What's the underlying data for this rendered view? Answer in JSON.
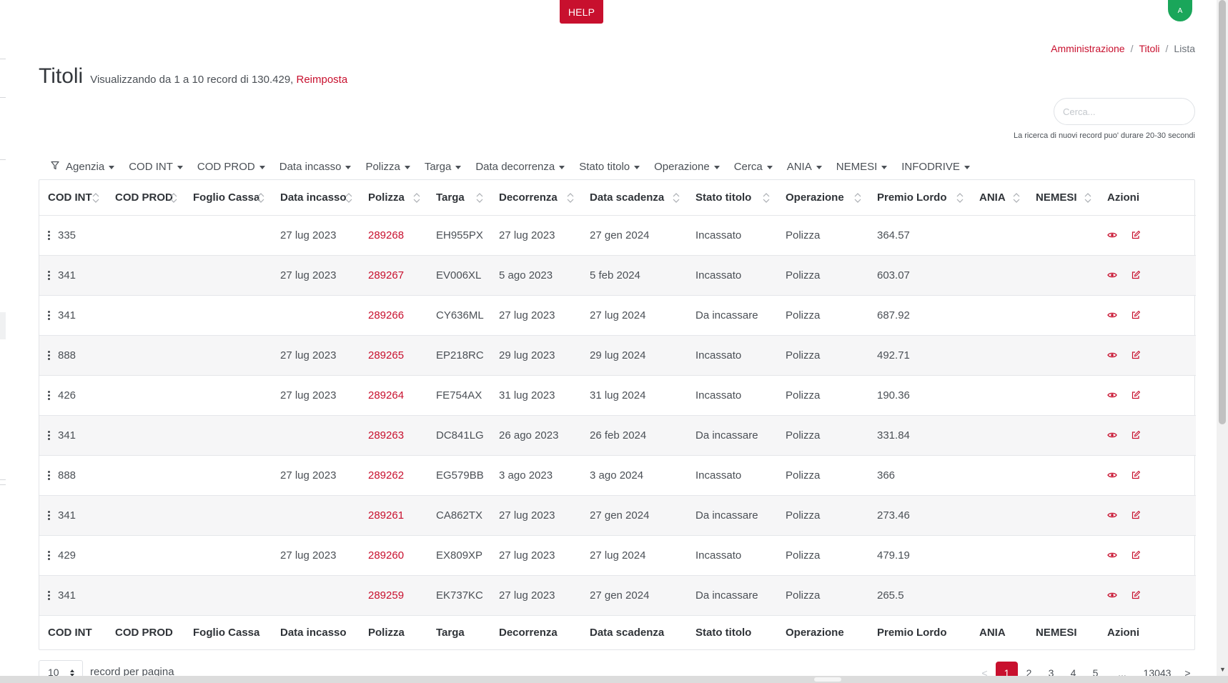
{
  "header": {
    "help_label": "HELP",
    "avatar_initial": "A"
  },
  "breadcrumb": {
    "items": [
      "Amministrazione",
      "Titoli"
    ],
    "current": "Lista",
    "separator": "/"
  },
  "page": {
    "title": "Titoli",
    "subtitle": "Visualizzando da 1 a 10 record di 130.429,",
    "reset_label": "Reimposta"
  },
  "search": {
    "placeholder": "Cerca...",
    "note": "La ricerca di nuovi record puo' durare 20-30 secondi"
  },
  "filters": [
    "Agenzia",
    "COD INT",
    "COD PROD",
    "Data incasso",
    "Polizza",
    "Targa",
    "Data decorrenza",
    "Stato titolo",
    "Operazione",
    "Cerca",
    "ANIA",
    "NEMESI",
    "INFODRIVE"
  ],
  "table": {
    "columns": [
      "COD INT",
      "COD PROD",
      "Foglio Cassa",
      "Data incasso",
      "Polizza",
      "Targa",
      "Decorrenza",
      "Data scadenza",
      "Stato titolo",
      "Operazione",
      "Premio Lordo",
      "ANIA",
      "NEMESI",
      "Azioni"
    ],
    "rows": [
      {
        "cod_int": "335",
        "cod_prod": "",
        "foglio_cassa": "",
        "data_incasso": "27 lug 2023",
        "polizza": "289268",
        "targa": "EH955PX",
        "decorrenza": "27 lug 2023",
        "data_scadenza": "27 gen 2024",
        "stato": "Incassato",
        "operazione": "Polizza",
        "premio": "364.57",
        "ania": "",
        "nemesi": ""
      },
      {
        "cod_int": "341",
        "cod_prod": "",
        "foglio_cassa": "",
        "data_incasso": "27 lug 2023",
        "polizza": "289267",
        "targa": "EV006XL",
        "decorrenza": "5 ago 2023",
        "data_scadenza": "5 feb 2024",
        "stato": "Incassato",
        "operazione": "Polizza",
        "premio": "603.07",
        "ania": "",
        "nemesi": ""
      },
      {
        "cod_int": "341",
        "cod_prod": "",
        "foglio_cassa": "",
        "data_incasso": "",
        "polizza": "289266",
        "targa": "CY636ML",
        "decorrenza": "27 lug 2023",
        "data_scadenza": "27 lug 2024",
        "stato": "Da incassare",
        "operazione": "Polizza",
        "premio": "687.92",
        "ania": "",
        "nemesi": ""
      },
      {
        "cod_int": "888",
        "cod_prod": "",
        "foglio_cassa": "",
        "data_incasso": "27 lug 2023",
        "polizza": "289265",
        "targa": "EP218RC",
        "decorrenza": "29 lug 2023",
        "data_scadenza": "29 lug 2024",
        "stato": "Incassato",
        "operazione": "Polizza",
        "premio": "492.71",
        "ania": "",
        "nemesi": ""
      },
      {
        "cod_int": "426",
        "cod_prod": "",
        "foglio_cassa": "",
        "data_incasso": "27 lug 2023",
        "polizza": "289264",
        "targa": "FE754AX",
        "decorrenza": "31 lug 2023",
        "data_scadenza": "31 lug 2024",
        "stato": "Incassato",
        "operazione": "Polizza",
        "premio": "190.36",
        "ania": "",
        "nemesi": ""
      },
      {
        "cod_int": "341",
        "cod_prod": "",
        "foglio_cassa": "",
        "data_incasso": "",
        "polizza": "289263",
        "targa": "DC841LG",
        "decorrenza": "26 ago 2023",
        "data_scadenza": "26 feb 2024",
        "stato": "Da incassare",
        "operazione": "Polizza",
        "premio": "331.84",
        "ania": "",
        "nemesi": ""
      },
      {
        "cod_int": "888",
        "cod_prod": "",
        "foglio_cassa": "",
        "data_incasso": "27 lug 2023",
        "polizza": "289262",
        "targa": "EG579BB",
        "decorrenza": "3 ago 2023",
        "data_scadenza": "3 ago 2024",
        "stato": "Incassato",
        "operazione": "Polizza",
        "premio": "366",
        "ania": "",
        "nemesi": ""
      },
      {
        "cod_int": "341",
        "cod_prod": "",
        "foglio_cassa": "",
        "data_incasso": "",
        "polizza": "289261",
        "targa": "CA862TX",
        "decorrenza": "27 lug 2023",
        "data_scadenza": "27 gen 2024",
        "stato": "Da incassare",
        "operazione": "Polizza",
        "premio": "273.46",
        "ania": "",
        "nemesi": ""
      },
      {
        "cod_int": "429",
        "cod_prod": "",
        "foglio_cassa": "",
        "data_incasso": "27 lug 2023",
        "polizza": "289260",
        "targa": "EX809XP",
        "decorrenza": "27 lug 2023",
        "data_scadenza": "27 lug 2024",
        "stato": "Incassato",
        "operazione": "Polizza",
        "premio": "479.19",
        "ania": "",
        "nemesi": ""
      },
      {
        "cod_int": "341",
        "cod_prod": "",
        "foglio_cassa": "",
        "data_incasso": "",
        "polizza": "289259",
        "targa": "EK737KC",
        "decorrenza": "27 lug 2023",
        "data_scadenza": "27 gen 2024",
        "stato": "Da incassare",
        "operazione": "Polizza",
        "premio": "265.5",
        "ania": "",
        "nemesi": ""
      }
    ],
    "row_action_icons": [
      "eye-icon",
      "edit-icon"
    ]
  },
  "footer": {
    "per_page_value": "10",
    "per_page_label": "record per pagina",
    "pagination": {
      "prev": "<",
      "pages": [
        "1",
        "2",
        "3",
        "4",
        "5"
      ],
      "ellipsis": "...",
      "last": "13043",
      "next": ">",
      "active": "1"
    }
  },
  "colors": {
    "accent": "#c8102e",
    "avatar": "#1aa65a",
    "row_alt": "#f6f6f7"
  }
}
